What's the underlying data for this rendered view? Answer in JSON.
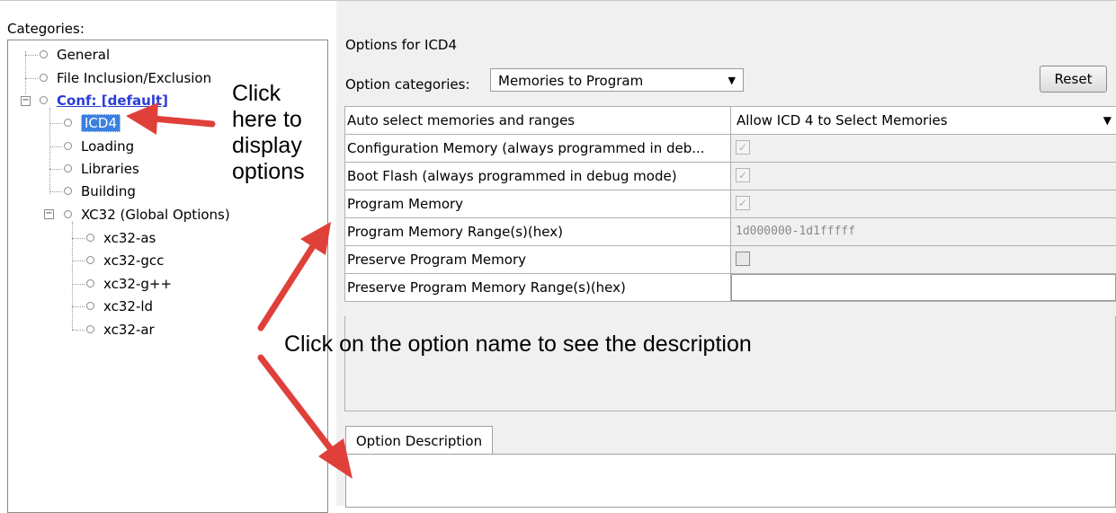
{
  "left": {
    "categories_label": "Categories:",
    "tree": {
      "general": "General",
      "file_inclusion": "File Inclusion/Exclusion",
      "conf": "Conf: [default]",
      "icd4": "ICD4",
      "loading": "Loading",
      "libraries": "Libraries",
      "building": "Building",
      "xc32": "XC32 (Global Options)",
      "xc32_as": "xc32-as",
      "xc32_gcc": "xc32-gcc",
      "xc32_gpp": "xc32-g++",
      "xc32_ld": "xc32-ld",
      "xc32_ar": "xc32-ar"
    }
  },
  "annotations": {
    "click_here": [
      "Click",
      "here to",
      "display",
      "options"
    ],
    "click_option": "Click on the option name to see the description",
    "arrow_color": "#e0403a"
  },
  "right": {
    "options_for": "Options for ICD4",
    "option_categories_label": "Option categories:",
    "option_categories_value": "Memories to Program",
    "reset_label": "Reset",
    "rows": [
      {
        "name": "Auto select memories and ranges",
        "value": "Allow ICD 4 to Select Memories",
        "kind": "combo"
      },
      {
        "name": "Configuration Memory (always programmed in deb...",
        "kind": "checkbox",
        "checked": true,
        "enabled": false
      },
      {
        "name": "Boot Flash (always programmed in debug mode)",
        "kind": "checkbox",
        "checked": true,
        "enabled": false
      },
      {
        "name": "Program Memory",
        "kind": "checkbox",
        "checked": true,
        "enabled": false
      },
      {
        "name": "Program Memory Range(s)(hex)",
        "value": "1d000000-1d1fffff",
        "kind": "text",
        "enabled": false
      },
      {
        "name": "Preserve Program Memory",
        "kind": "checkbox",
        "checked": false,
        "enabled": true
      },
      {
        "name": "Preserve Program Memory Range(s)(hex)",
        "value": "",
        "kind": "text",
        "enabled": true
      }
    ],
    "description_tab": "Option Description"
  },
  "colors": {
    "selection": "#3b7fe0",
    "link": "#2a3cd8",
    "panel_bg": "#f0f0f0"
  }
}
